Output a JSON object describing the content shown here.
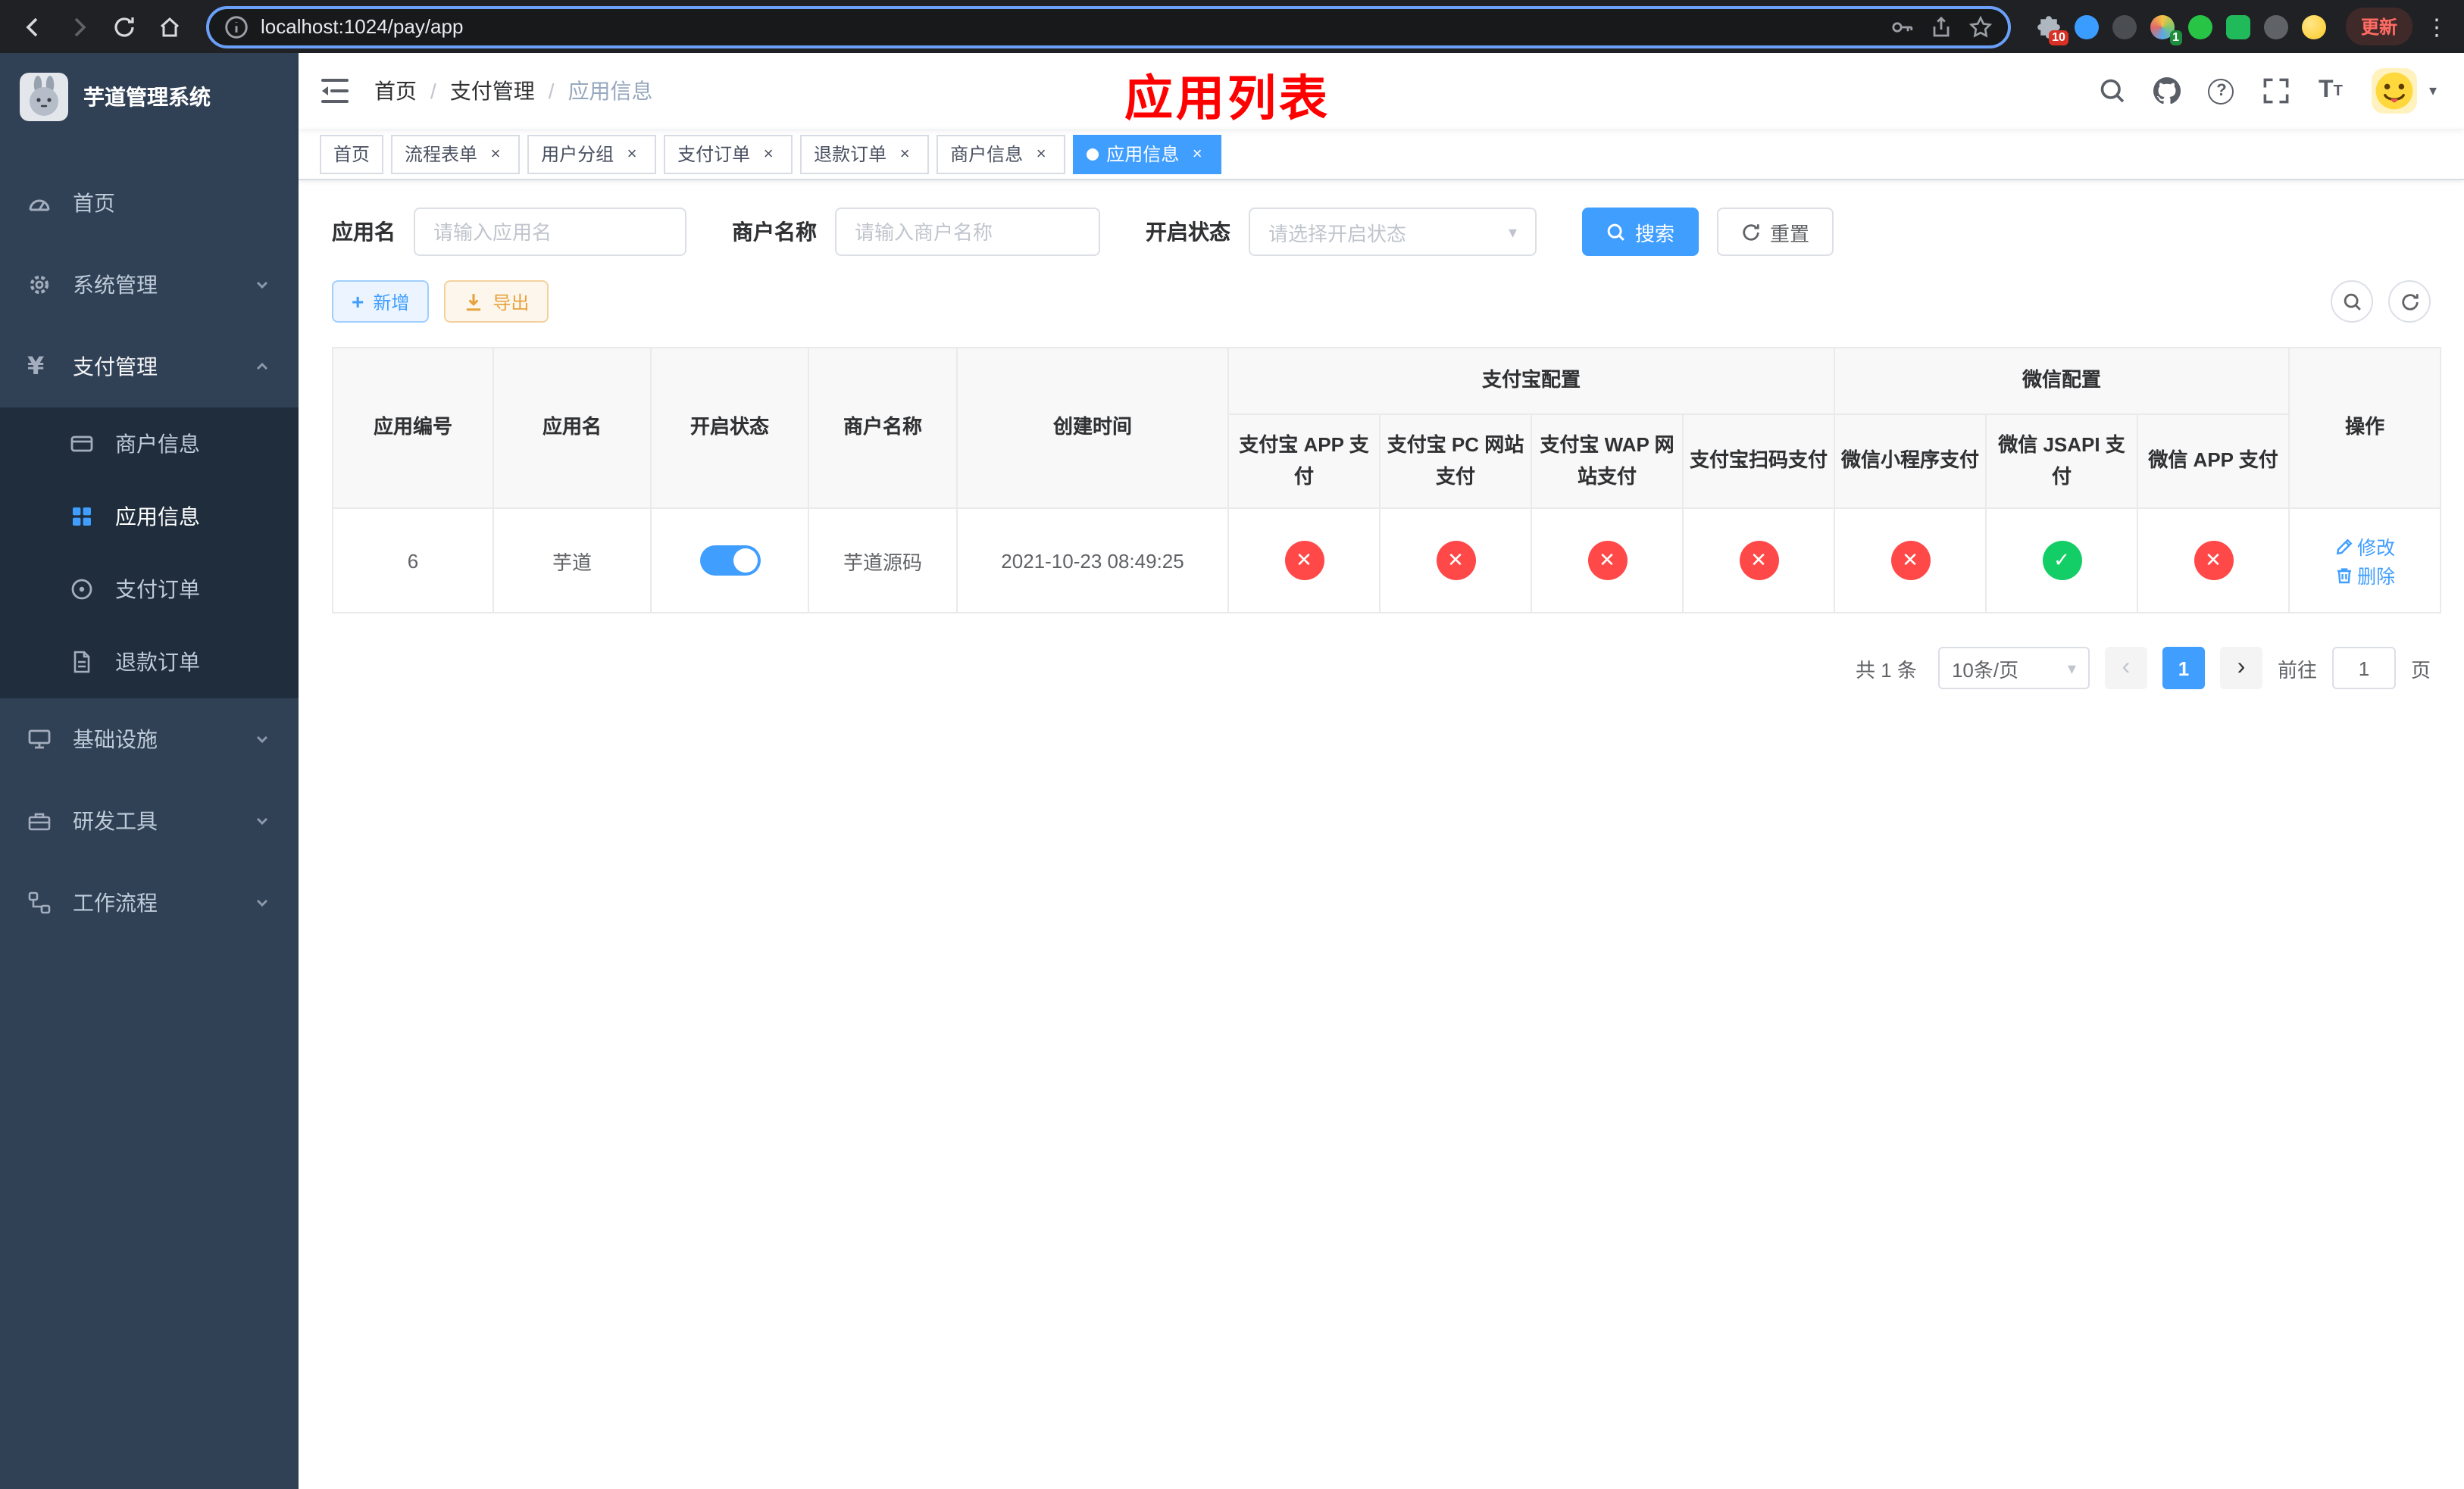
{
  "browser": {
    "url": "localhost:1024/pay/app",
    "update_label": "更新",
    "extensions_badge_red": "10",
    "extensions_badge_green": "1"
  },
  "sidebar": {
    "title": "芋道管理系统",
    "items": [
      {
        "label": "首页"
      },
      {
        "label": "系统管理"
      },
      {
        "label": "支付管理"
      },
      {
        "label": "商户信息"
      },
      {
        "label": "应用信息"
      },
      {
        "label": "支付订单"
      },
      {
        "label": "退款订单"
      },
      {
        "label": "基础设施"
      },
      {
        "label": "研发工具"
      },
      {
        "label": "工作流程"
      }
    ]
  },
  "navbar": {
    "breadcrumb": [
      "首页",
      "支付管理",
      "应用信息"
    ],
    "annotation": "应用列表"
  },
  "tabs": [
    {
      "label": "首页"
    },
    {
      "label": "流程表单"
    },
    {
      "label": "用户分组"
    },
    {
      "label": "支付订单"
    },
    {
      "label": "退款订单"
    },
    {
      "label": "商户信息"
    },
    {
      "label": "应用信息"
    }
  ],
  "filters": {
    "app_name": {
      "label": "应用名",
      "placeholder": "请输入应用名"
    },
    "merchant_name": {
      "label": "商户名称",
      "placeholder": "请输入商户名称"
    },
    "status": {
      "label": "开启状态",
      "placeholder": "请选择开启状态"
    },
    "search_label": "搜索",
    "reset_label": "重置"
  },
  "toolbar": {
    "add_label": "新增",
    "export_label": "导出"
  },
  "table": {
    "groups": {
      "alipay": "支付宝配置",
      "wechat": "微信配置"
    },
    "columns": {
      "id": "应用编号",
      "name": "应用名",
      "status": "开启状态",
      "merchant": "商户名称",
      "created": "创建时间",
      "alipay_app": "支付宝 APP 支付",
      "alipay_pc": "支付宝 PC 网站支付",
      "alipay_wap": "支付宝 WAP 网站支付",
      "alipay_qr": "支付宝扫码支付",
      "wx_mini": "微信小程序支付",
      "wx_jsapi": "微信 JSAPI 支付",
      "wx_app": "微信 APP 支付",
      "ops": "操作"
    },
    "row": {
      "id": "6",
      "name": "芋道",
      "enabled": true,
      "merchant": "芋道源码",
      "created": "2021-10-23 08:49:25",
      "alipay_app": false,
      "alipay_pc": false,
      "alipay_wap": false,
      "alipay_qr": false,
      "wx_mini": false,
      "wx_jsapi": true,
      "wx_app": false,
      "edit_label": "修改",
      "delete_label": "删除"
    }
  },
  "pagination": {
    "total": "共 1 条",
    "page_size": "10条/页",
    "current_page": "1",
    "goto_label": "前往",
    "goto_value": "1",
    "unit_label": "页"
  },
  "colors": {
    "accent": "#409eff",
    "danger": "#ff4949",
    "success": "#13ce66",
    "sidebar_bg": "#304156",
    "sidebar_sub_bg": "#1f2d3d",
    "annotation": "#ff0000"
  }
}
